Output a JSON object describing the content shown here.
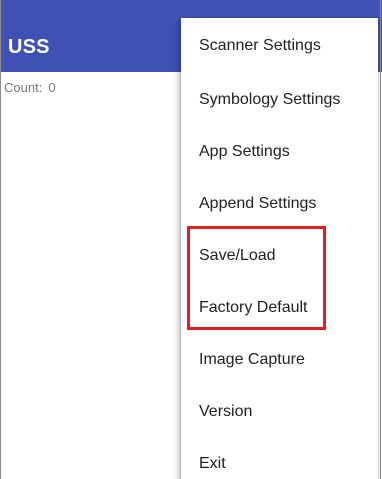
{
  "app_bar": {
    "title": "USS",
    "color": "#3f51b5"
  },
  "content": {
    "count_label": "Count:",
    "count_value": "0"
  },
  "menu": {
    "items": [
      {
        "label": "Scanner Settings"
      },
      {
        "label": "Symbology Settings"
      },
      {
        "label": "App Settings"
      },
      {
        "label": "Append Settings"
      },
      {
        "label": "Save/Load"
      },
      {
        "label": "Factory Default"
      },
      {
        "label": "Image Capture"
      },
      {
        "label": "Version"
      },
      {
        "label": "Exit"
      }
    ]
  },
  "annotation": {
    "highlight_color": "#e11d1d",
    "highlighted_items": [
      "Save/Load",
      "Factory Default"
    ]
  }
}
